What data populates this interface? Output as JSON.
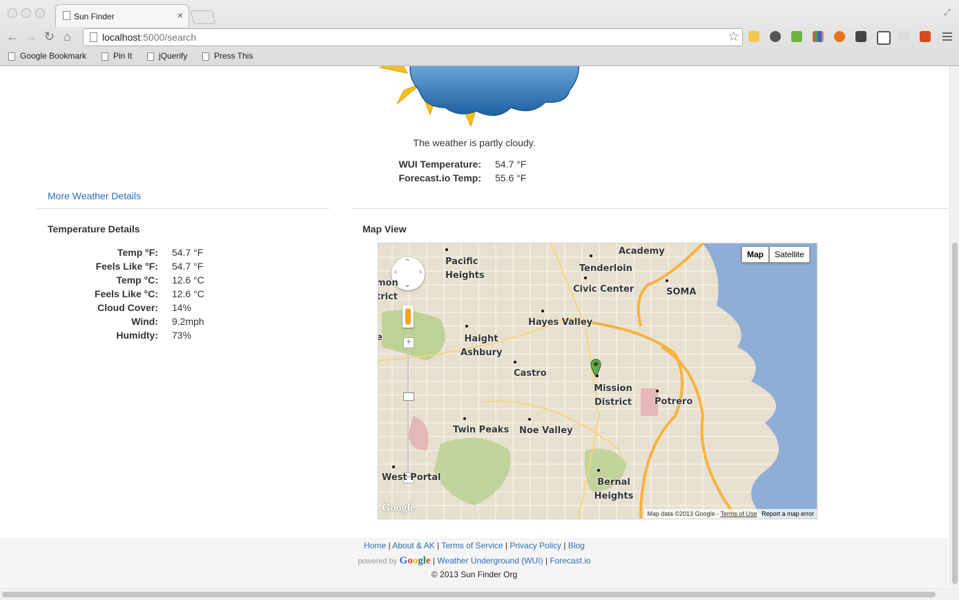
{
  "browser": {
    "tab_title": "Sun Finder",
    "url_host": "localhost",
    "url_rest": ":5000/search",
    "bookmarks": [
      "Google Bookmark",
      "Pin It",
      "jQuerify",
      "Press This"
    ]
  },
  "weather": {
    "summary": "The weather is partly cloudy.",
    "wui_label": "WUI Temperature:",
    "wui_value": "54.7 °F",
    "forecast_label": "Forecast.io Temp:",
    "forecast_value": "55.6 °F",
    "more_link": "More Weather Details"
  },
  "temperature_details": {
    "heading": "Temperature Details",
    "rows": [
      {
        "label": "Temp °F:",
        "value": "54.7 °F"
      },
      {
        "label": "Feels Like °F:",
        "value": "54.7 °F"
      },
      {
        "label": "Temp °C:",
        "value": "12.6 °C"
      },
      {
        "label": "Feels Like °C:",
        "value": "12.6 °C"
      },
      {
        "label": "Cloud Cover:",
        "value": "14%"
      },
      {
        "label": "Wind:",
        "value": "9.2mph"
      },
      {
        "label": "Humidty:",
        "value": "73%"
      }
    ]
  },
  "map": {
    "heading": "Map View",
    "type_map": "Map",
    "type_satellite": "Satellite",
    "google_logo": "Google",
    "copyright": "Map data ©2013 Google -",
    "terms": "Terms of Use",
    "report": "Report a map error",
    "labels": {
      "pacific_heights": "Pacific Heights",
      "tenderloin": "Tenderloin",
      "civic_center": "Civic Center",
      "academy": "Academy",
      "soma": "SOMA",
      "hayes_valley": "Hayes Valley",
      "haight": "Haight Ashbury",
      "castro": "Castro",
      "mission": "Mission District",
      "potrero": "Potrero",
      "twin_peaks": "Twin Peaks",
      "noe_valley": "Noe Valley",
      "bernal": "Bernal Heights",
      "westportal": "West Portal",
      "edge_mon": "mon",
      "edge_trict": "trict",
      "edge_e": "e"
    }
  },
  "footer": {
    "links_row1": [
      "Home",
      "About & AK",
      "Terms of Service",
      "Privacy Policy",
      "Blog"
    ],
    "powered_by": "powered by",
    "google": "Google",
    "links_row2": [
      "Weather Underground (WUI)",
      "Forecast.io"
    ],
    "copyright": "© 2013 Sun Finder Org"
  }
}
